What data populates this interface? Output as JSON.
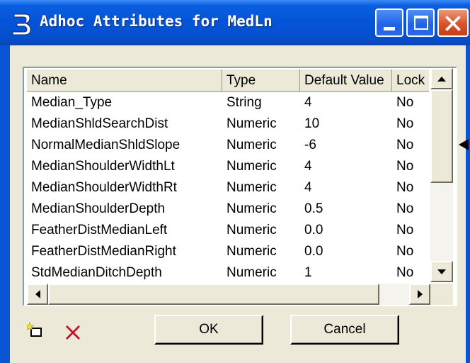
{
  "window": {
    "title": "Adhoc Attributes for MedLn",
    "icons": {
      "app": "bentley-b-icon",
      "minimize": "minimize-icon",
      "maximize": "maximize-icon",
      "close": "close-icon"
    },
    "colors": {
      "titlebar": "#0554d8",
      "close": "#d9532c",
      "face": "#ece9d8",
      "delete_x": "#c8102e"
    }
  },
  "table": {
    "columns": [
      "Name",
      "Type",
      "Default Value",
      "Lock"
    ],
    "rows": [
      {
        "name": "Median_Type",
        "type": "String",
        "default": "4",
        "lock": "No"
      },
      {
        "name": "MedianShldSearchDist",
        "type": "Numeric",
        "default": "10",
        "lock": "No"
      },
      {
        "name": "NormalMedianShldSlope",
        "type": "Numeric",
        "default": "-6",
        "lock": "No"
      },
      {
        "name": "MedianShoulderWidthLt",
        "type": "Numeric",
        "default": "4",
        "lock": "No"
      },
      {
        "name": "MedianShoulderWidthRt",
        "type": "Numeric",
        "default": "4",
        "lock": "No"
      },
      {
        "name": "MedianShoulderDepth",
        "type": "Numeric",
        "default": "0.5",
        "lock": "No"
      },
      {
        "name": "FeatherDistMedianLeft",
        "type": "Numeric",
        "default": "0.0",
        "lock": "No"
      },
      {
        "name": "FeatherDistMedianRight",
        "type": "Numeric",
        "default": "0.0",
        "lock": "No"
      },
      {
        "name": "StdMedianDitchDepth",
        "type": "Numeric",
        "default": "1",
        "lock": "No"
      }
    ]
  },
  "toolbar": {
    "add_icon": "new-attribute-icon",
    "delete_icon": "delete-attribute-icon"
  },
  "buttons": {
    "ok": "OK",
    "cancel": "Cancel"
  }
}
